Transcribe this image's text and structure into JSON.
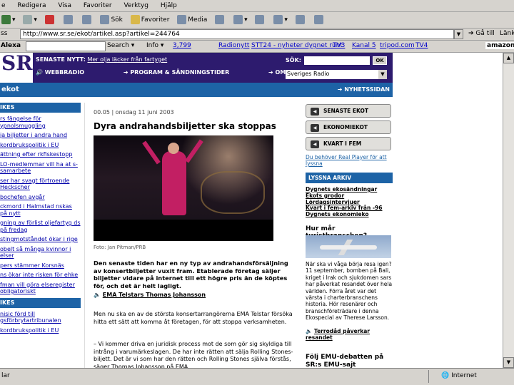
{
  "browser": {
    "menu": [
      "e",
      "Redigera",
      "Visa",
      "Favoriter",
      "Verktyg",
      "Hjälp"
    ],
    "toolbar": {
      "search": "Sök",
      "favorites": "Favoriter",
      "media": "Media"
    },
    "address_label": "ss",
    "url": "http://www.sr.se/ekot/artikel.asp?artikel=244764",
    "go": "Gå till",
    "links": "Länka",
    "alexa": "Alexa",
    "alexa_search": "Search",
    "alexa_info": "Info",
    "alexa_count": "3,799",
    "alexa_links": [
      "Radionytt",
      "STT24 - nyheter dygnet runt",
      "TV3",
      "Kanal 5",
      "tripod.com",
      "TV4"
    ],
    "amazon": "amazon.co",
    "status_left": "lar",
    "status_zone": "Internet"
  },
  "sr": {
    "logo": "SR",
    "logo_sub": "www.sr.se",
    "senaste_label": "SENASTE NYTT:",
    "senaste_text": "Mer olja läcker från fartyget",
    "nav": [
      "WEBBRADIO",
      "PROGRAM & SÄNDNINGSTIDER",
      "OM SR"
    ],
    "sok_label": "SÖK:",
    "ok": "OK",
    "select": "Sveriges Radio"
  },
  "ekot": {
    "title": "ekot",
    "nyhetssidan": "NYHETSSIDAN"
  },
  "left": {
    "head1": "IKES",
    "items1": [
      "rs fängelse för ypnolsmuggling",
      "ja biljetter i andra hand",
      "kordbrukspolitik i EU",
      "ättning efter rkfiskestopp",
      "LO-medlemmar vill ha at s-samarbete",
      "ser har svagt förtroende Heckscher",
      "bochefen avgår",
      "ckmord i Halmstad nskas på nytt",
      "gning av förlist oljefartyg ds på fredag",
      "stingmotståndet ökar i rige",
      "obelt så många kvinnor i elser",
      "pers stämmer Korsnäs",
      "ns ökar inte risken för ehke",
      "fman vill göra elseregister obligatoriskt"
    ],
    "head2": "IKES",
    "items2": [
      "nisic förd till gsförbrytartribunalen",
      "kordbrukspolitik i EU"
    ]
  },
  "article": {
    "meta": "00.05 | onsdag 11 juni 2003",
    "headline": "Dyra andrahandsbiljetter ska stoppas",
    "caption": "Foto: Jan Pitman/PRB",
    "lead": "Den senaste tiden har en ny typ av andrahandsförsäljning av konsertbiljetter vuxit fram. Etablerade företag säljer biljetter vidare på internet till ett högre pris än de köptes för, och det är helt lagligt.",
    "audio": "EMA Telstars Thomas Johansson",
    "body1": "Men nu ska en av de största konsertarrangörerna EMA Telstar försöka hitta ett sätt att komma åt företagen, för att stoppa verksamheten.",
    "body2": "– Vi kommer driva en juridisk process mot de som gör sig skyldiga till intrång i varumärkeslagen. De har inte rätten att sälja Rolling Stones-biljett. Det är vi som har den rätten och Rolling Stones själva förstås, säger Thomas Johansson på EMA"
  },
  "right": {
    "buttons": [
      "SENASTE EKOT",
      "EKONOMIEKOT",
      "KVART I FEM"
    ],
    "realplayer": "Du behöver Real Player för att lyssna",
    "lyssna_head": "LYSSNA ARKIV",
    "lyssna": [
      "Dygnets ekosändningar",
      "Ekots grodor",
      "Lördagsintervjuer",
      "Kvart i fem-arkiv från -96",
      "Dygnets ekonomieko"
    ],
    "turist_head": "Hur mår turistbranschen?",
    "turist_text": "När ska vi våga börja resa igen? 11 september, bomben på Bali, kriget i Irak och sjukdomen sars har påverkat resandet över hela världen. Förra året var det värsta i charterbranschens historia. Hör resenärer och branschföreträdare i denna Ekospecial av Therese Larsson.",
    "turist_link": "Terrodåd påverkar resandet",
    "emu": "Följ EMU-debatten på SR:s EMU-sajt"
  }
}
